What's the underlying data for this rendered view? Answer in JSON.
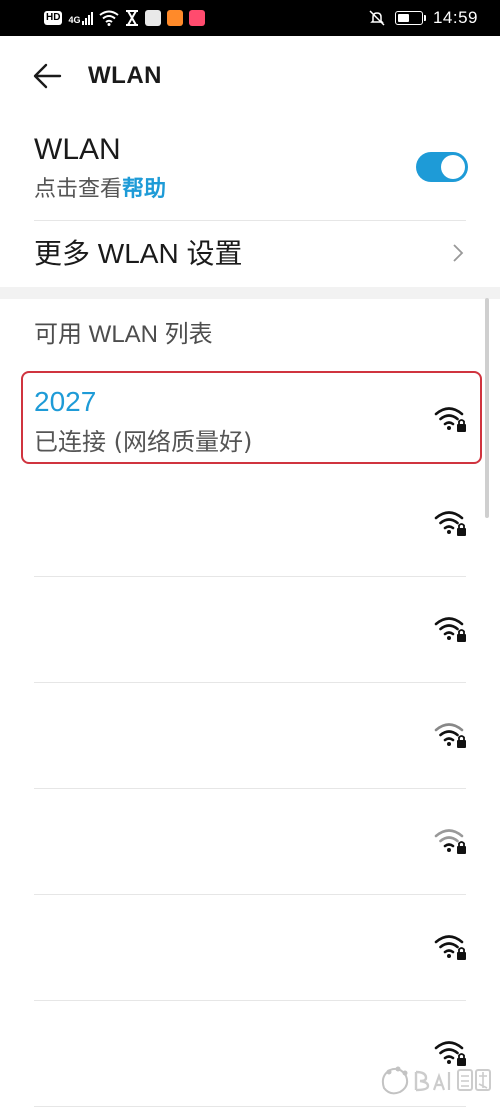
{
  "status_bar": {
    "left_icons": [
      "hd-icon",
      "4g-signal-icon",
      "wifi-status-icon",
      "hourglass-icon",
      "app-notification-icon",
      "weibo-icon",
      "app-notification-icon-2"
    ],
    "hd_label": "HD",
    "network_label": "4G",
    "time": "14:59",
    "right_icons": [
      "mute-bell-icon",
      "battery-icon"
    ],
    "battery_level": 0.5
  },
  "header": {
    "title": "WLAN",
    "back_icon": "arrow-left-icon"
  },
  "wlan_toggle": {
    "title": "WLAN",
    "subtitle_prefix": "点击查看",
    "help_link": "帮助",
    "enabled": true
  },
  "more_settings": {
    "label": "更多 WLAN 设置",
    "chevron_icon": "chevron-right-icon"
  },
  "available_list": {
    "header": "可用 WLAN 列表",
    "connected": {
      "name": "2027",
      "status": "已连接 (网络质量好)"
    },
    "networks": [
      {
        "signal_icon": "wifi-lock-icon"
      },
      {
        "signal_icon": "wifi-lock-icon"
      },
      {
        "signal_icon": "wifi-lock-icon"
      },
      {
        "signal_icon": "wifi-lock-icon"
      },
      {
        "signal_icon": "wifi-lock-icon"
      },
      {
        "signal_icon": "wifi-lock-icon"
      }
    ]
  },
  "colors": {
    "accent": "#1e9bd7",
    "highlight_border": "#d0343f",
    "status_bar_bg": "#000000",
    "section_gap": "#f2f2f2"
  },
  "watermark": {
    "icon": "baidu-experience-watermark"
  }
}
